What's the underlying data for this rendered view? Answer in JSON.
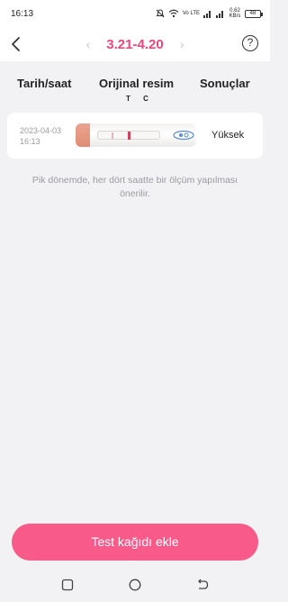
{
  "status_bar": {
    "time": "16:13",
    "network_label": "Vo LTE",
    "speed_label": "0.62 KB/s",
    "battery": "48"
  },
  "header": {
    "period": "3.21-4.20",
    "back_icon": "chevron-left-icon",
    "help_icon": "question-circle-icon",
    "help_symbol": "?"
  },
  "columns": {
    "date": "Tarih/saat",
    "image": "Orijinal resim",
    "tc": "T C",
    "result": "Sonuçlar"
  },
  "rows": [
    {
      "date": "2023-04-03",
      "time": "16:13",
      "result": "Yüksek"
    }
  ],
  "note": "Pik dönemde, her dört saatte bir ölçüm yapılması önerilir.",
  "add_button": "Test kağıdı ekle",
  "colors": {
    "accent": "#e8467c",
    "button": "#f85a8a",
    "background": "#f2f2f5"
  }
}
